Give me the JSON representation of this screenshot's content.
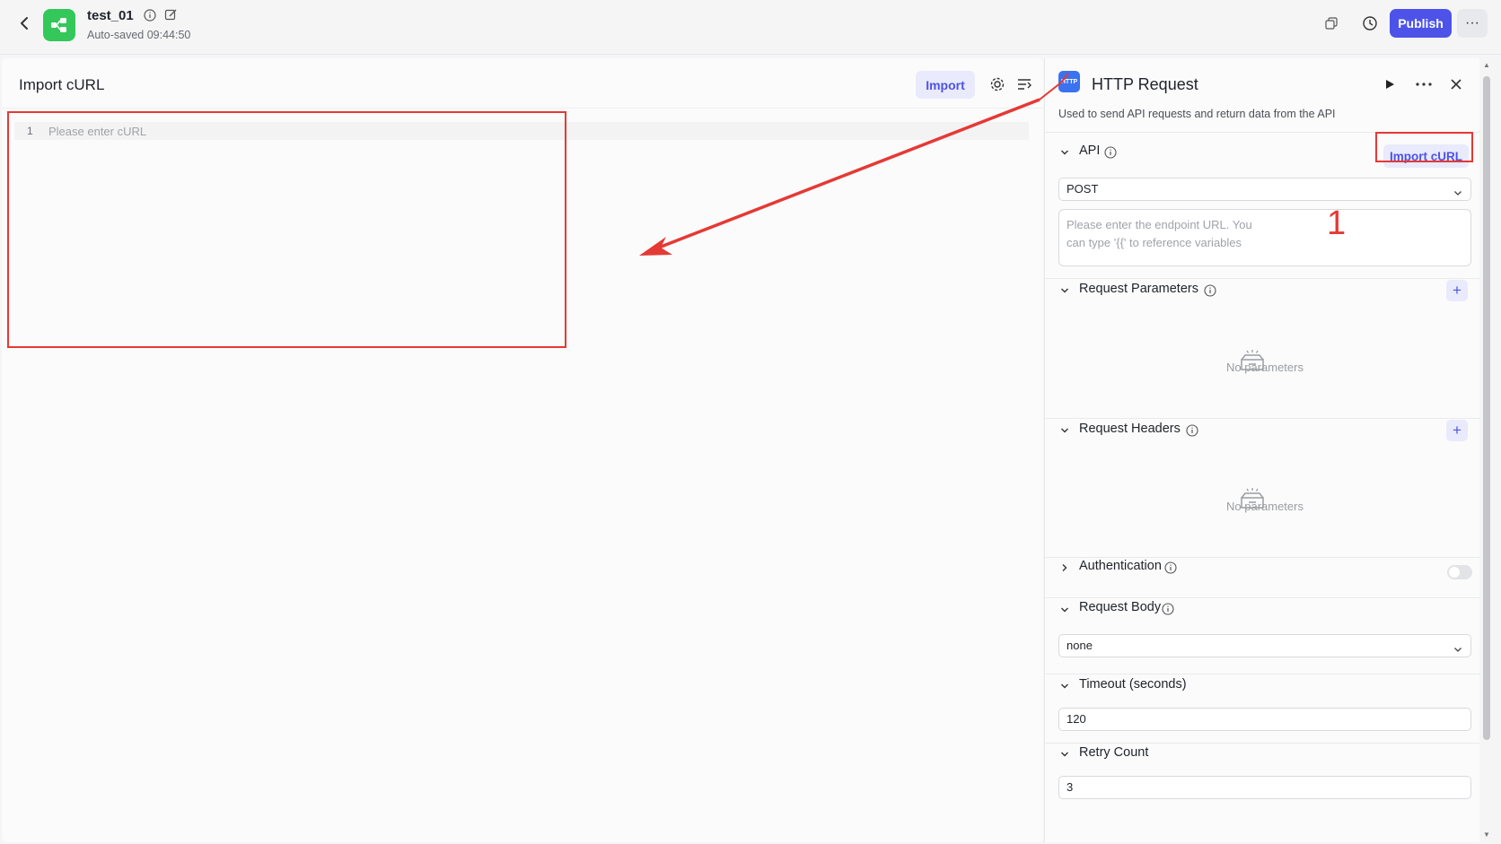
{
  "header": {
    "title": "test_01",
    "autosave": "Auto-saved 09:44:50",
    "publish_label": "Publish",
    "more_label": "···"
  },
  "left_panel": {
    "title": "Import cURL",
    "import_label": "Import",
    "line_number": "1",
    "editor_placeholder": "Please enter cURL"
  },
  "node": {
    "logo_text": "HTTP",
    "title": "HTTP Request",
    "description": "Used to send API requests and return data from the API",
    "api": {
      "label": "API",
      "import_curl_label": "Import cURL",
      "method": "POST",
      "url_placeholder_line1": "Please enter the endpoint URL. You",
      "url_placeholder_line2": "can type '{{' to reference variables"
    },
    "request_parameters": {
      "label": "Request Parameters",
      "add_label": "+",
      "empty_text": "No parameters"
    },
    "request_headers": {
      "label": "Request Headers",
      "add_label": "+",
      "empty_text": "No parameters"
    },
    "authentication": {
      "label": "Authentication",
      "enabled": false
    },
    "request_body": {
      "label": "Request Body",
      "value": "none"
    },
    "timeout": {
      "label": "Timeout (seconds)",
      "value": "120"
    },
    "retry": {
      "label": "Retry Count",
      "value": "3"
    }
  },
  "annotations": {
    "step_number": "1",
    "color": "#e53935"
  },
  "colors": {
    "primary": "#4d53e8",
    "primary_light": "#e9eafc",
    "app_logo": "#34c759",
    "http_logo": "#3b72f1"
  }
}
